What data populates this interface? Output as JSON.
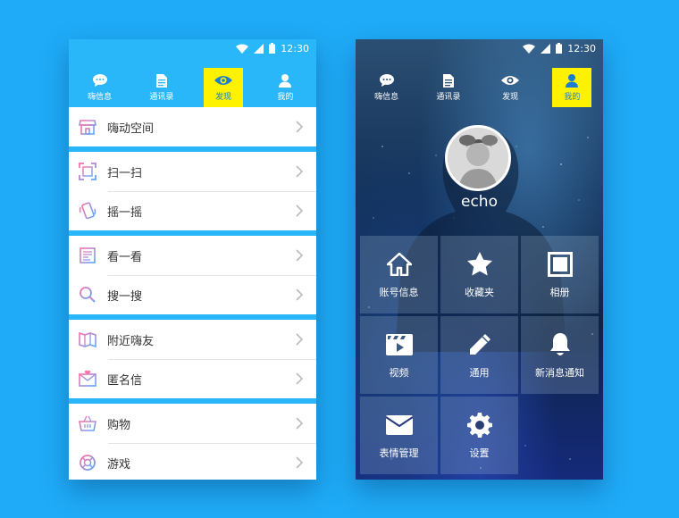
{
  "status": {
    "time": "12:30"
  },
  "tabs": [
    {
      "label": "嗨信息",
      "icon": "chat-bubble-icon"
    },
    {
      "label": "通讯录",
      "icon": "document-icon"
    },
    {
      "label": "发现",
      "icon": "eye-icon"
    },
    {
      "label": "我的",
      "icon": "person-icon"
    }
  ],
  "left": {
    "active_tab": "发现",
    "groups": [
      [
        {
          "label": "嗨动空间",
          "icon": "store-icon"
        }
      ],
      [
        {
          "label": "扫一扫",
          "icon": "scan-icon"
        },
        {
          "label": "摇一摇",
          "icon": "shake-phone-icon"
        }
      ],
      [
        {
          "label": "看一看",
          "icon": "newspaper-icon"
        },
        {
          "label": "搜一搜",
          "icon": "magnifier-icon"
        }
      ],
      [
        {
          "label": "附近嗨友",
          "icon": "map-icon"
        },
        {
          "label": "匿名信",
          "icon": "envelope-heart-icon"
        }
      ],
      [
        {
          "label": "购物",
          "icon": "basket-icon"
        },
        {
          "label": "游戏",
          "icon": "lifebuoy-icon"
        }
      ]
    ]
  },
  "right": {
    "active_tab": "我的",
    "username": "echo",
    "tiles": [
      {
        "label": "账号信息",
        "icon": "home-icon"
      },
      {
        "label": "收藏夹",
        "icon": "star-icon"
      },
      {
        "label": "相册",
        "icon": "album-icon"
      },
      {
        "label": "视频",
        "icon": "video-clapper-icon"
      },
      {
        "label": "通用",
        "icon": "pencil-icon"
      },
      {
        "label": "新消息通知",
        "icon": "bell-icon"
      },
      {
        "label": "表情管理",
        "icon": "envelope-icon"
      },
      {
        "label": "设置",
        "icon": "gear-icon"
      }
    ]
  },
  "colors": {
    "background": "#1fabf7",
    "active_tab": "#fff200",
    "tab_bar": "#2ab7fa"
  }
}
